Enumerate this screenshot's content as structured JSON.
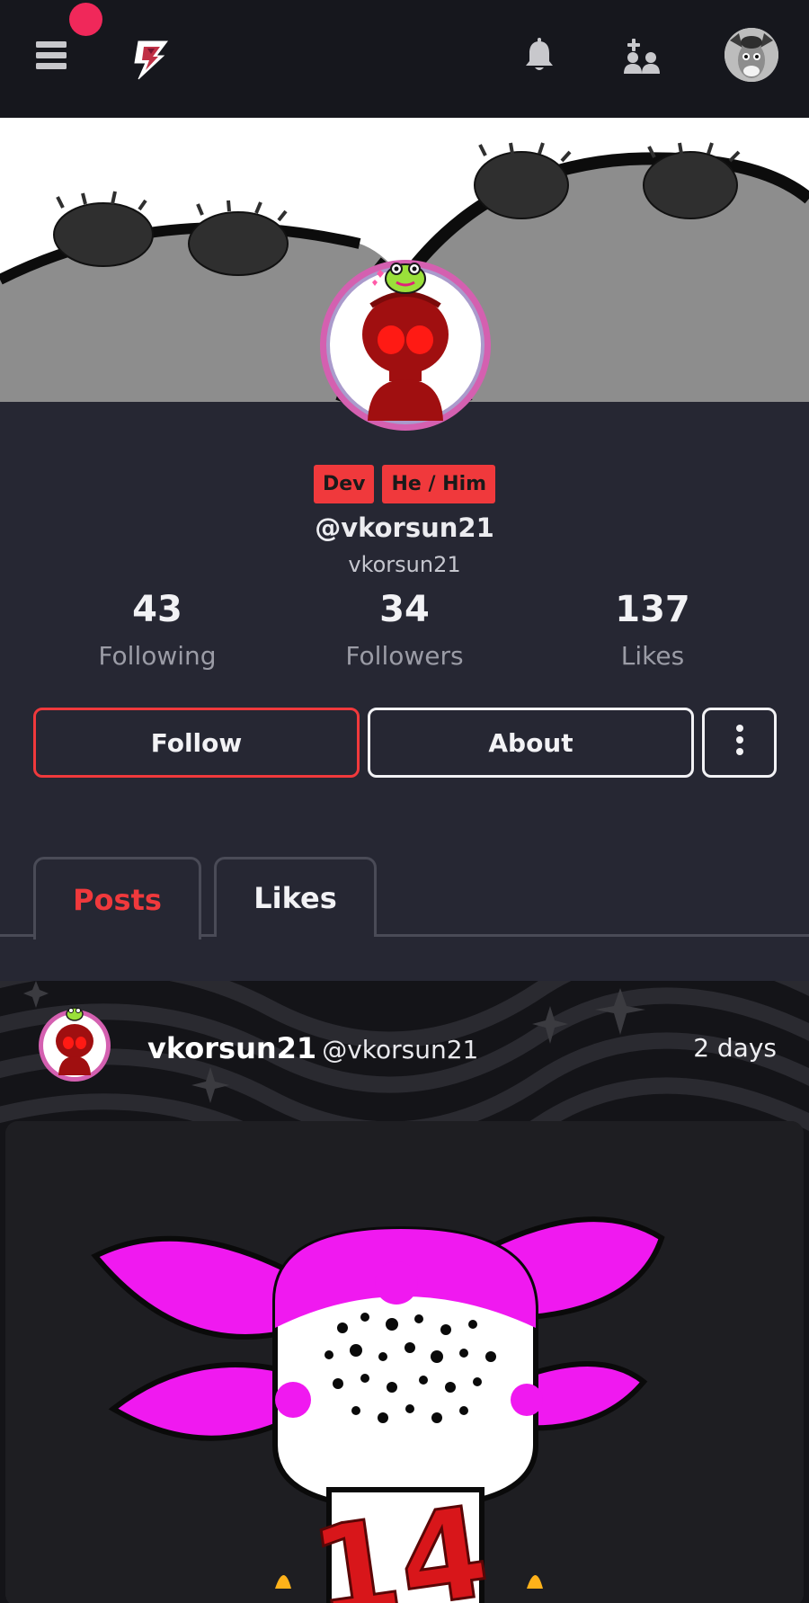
{
  "topbar": {
    "menu_icon": "hamburger-menu-icon",
    "logo_icon": "lightning-bolt-logo-icon",
    "notifications_icon": "bell-icon",
    "friends_icon": "add-friends-icon",
    "notification_color": "#f0285a"
  },
  "profile": {
    "badges": [
      "Dev",
      "He / Him"
    ],
    "handle": "@vkorsun21",
    "display_name": "vkorsun21",
    "stats": {
      "following": {
        "value": "43",
        "label": "Following"
      },
      "followers": {
        "value": "34",
        "label": "Followers"
      },
      "likes": {
        "value": "137",
        "label": "Likes"
      }
    }
  },
  "actions": {
    "follow_label": "Follow",
    "about_label": "About",
    "more_icon": "vertical-dots-icon"
  },
  "tabs": [
    {
      "label": "Posts",
      "active": true
    },
    {
      "label": "Likes",
      "active": false
    }
  ],
  "post": {
    "author": "vkorsun21",
    "handle": "@vkorsun21",
    "time": "2 days",
    "image_text": "14"
  },
  "colors": {
    "accent": "#f0393c",
    "background": "#262733",
    "topbar": "#16171d"
  }
}
